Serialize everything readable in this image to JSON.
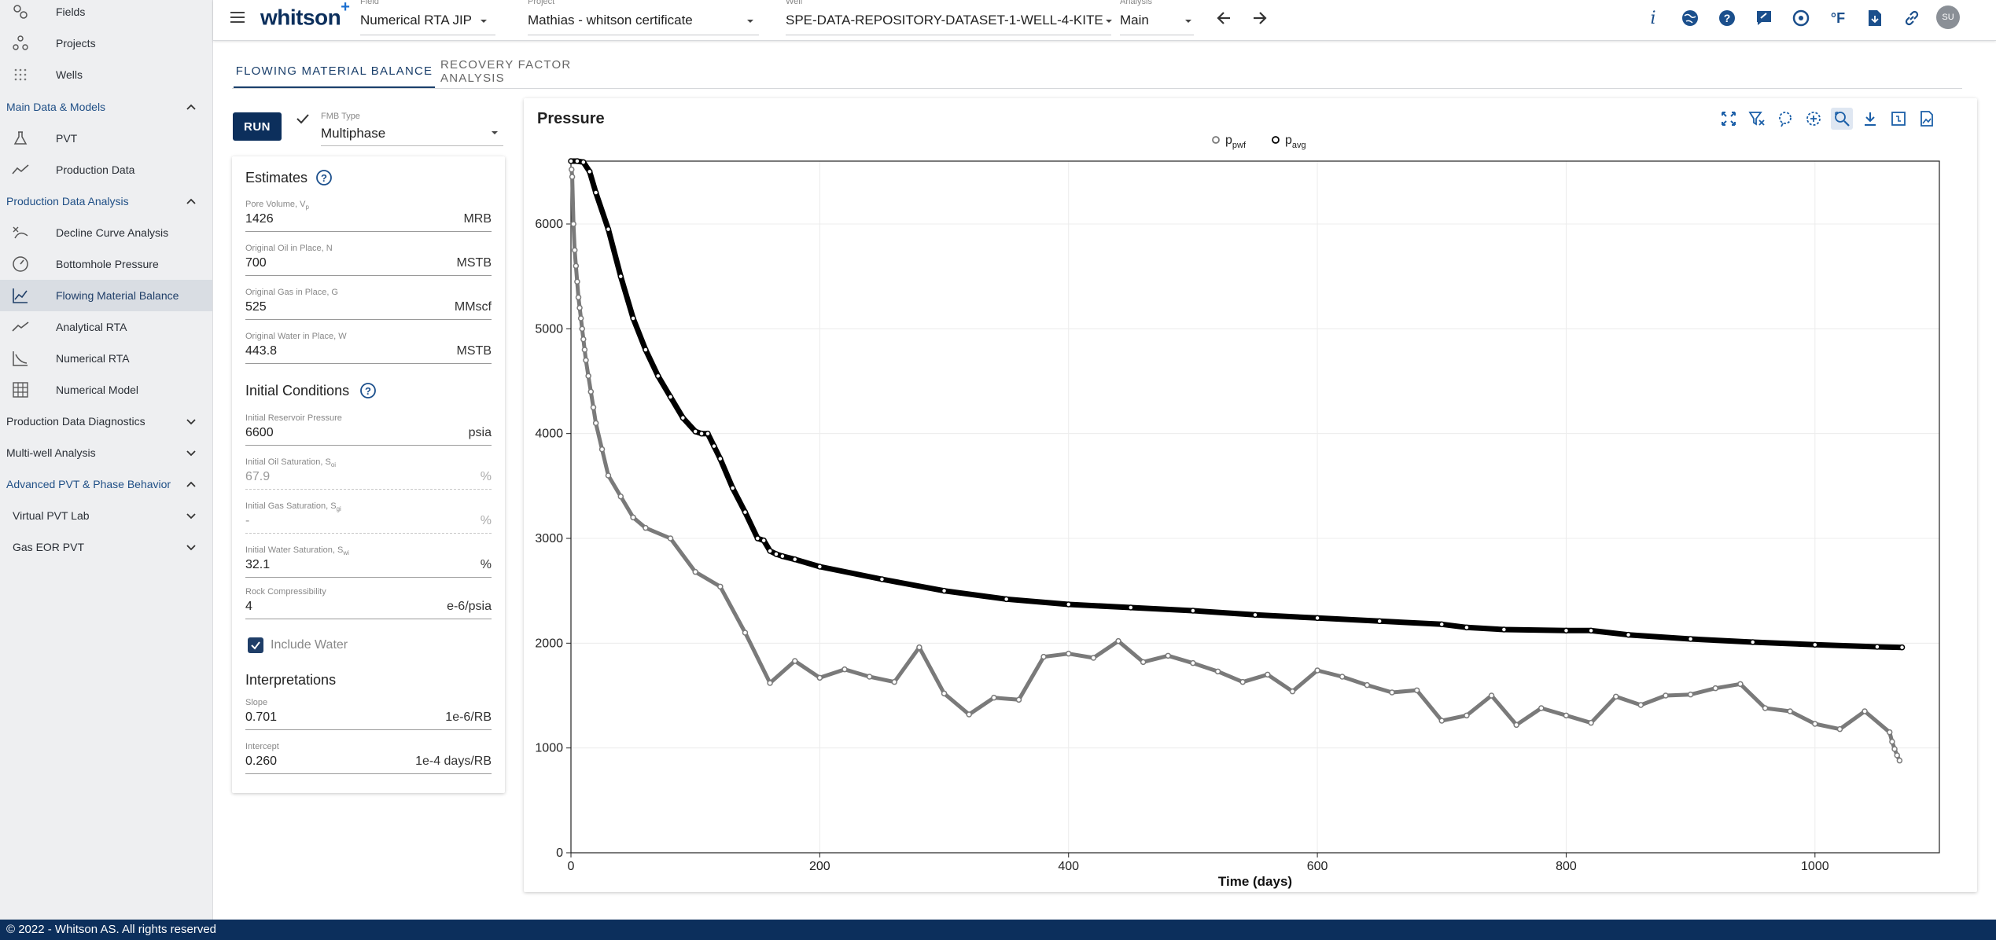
{
  "sidebar": {
    "top_items": [
      {
        "label": "Fields",
        "icon": "fields-icon"
      },
      {
        "label": "Projects",
        "icon": "projects-icon"
      },
      {
        "label": "Wells",
        "icon": "wells-icon"
      }
    ],
    "sections": {
      "main_data": "Main Data & Models",
      "production_analysis": "Production Data Analysis",
      "diagnostics": "Production Data Diagnostics",
      "multiwell": "Multi-well Analysis",
      "advanced_pvt": "Advanced PVT & Phase Behavior",
      "virtual_pvt": "Virtual PVT Lab",
      "gas_eor": "Gas EOR PVT"
    },
    "main_items": [
      {
        "label": "PVT",
        "icon": "flask-icon"
      },
      {
        "label": "Production Data",
        "icon": "trend-icon"
      }
    ],
    "analysis_items": [
      {
        "label": "Decline Curve Analysis",
        "icon": "decline-icon"
      },
      {
        "label": "Bottomhole Pressure",
        "icon": "gauge-icon"
      },
      {
        "label": "Flowing Material Balance",
        "icon": "fmb-icon",
        "active": true
      },
      {
        "label": "Analytical RTA",
        "icon": "rta-icon"
      },
      {
        "label": "Numerical RTA",
        "icon": "numerical-rta-icon"
      },
      {
        "label": "Numerical Model",
        "icon": "grid-icon"
      }
    ]
  },
  "topbar": {
    "logo": "whitson",
    "logo_plus": "+",
    "field_label": "Field",
    "field_value": "Numerical RTA JIP",
    "project_label": "Project",
    "project_value": "Mathias - whitson certificate",
    "well_label": "Well",
    "well_value": "SPE-DATA-REPOSITORY-DATASET-1-WELL-4-KITE",
    "analysis_label": "Analysis",
    "analysis_value": "Main",
    "avatar": "SU",
    "icons": [
      "info-icon",
      "globe-icon",
      "help-icon",
      "feedback-icon",
      "support-icon",
      "units-icon",
      "export-file-icon",
      "link-icon"
    ],
    "info_glyph": "i",
    "units_glyph": "°F"
  },
  "tabs": [
    {
      "label": "FLOWING MATERIAL BALANCE",
      "active": true
    },
    {
      "label": "RECOVERY FACTOR ANALYSIS",
      "active": false
    }
  ],
  "controls": {
    "run_label": "RUN",
    "fmb_type_label": "FMB Type",
    "fmb_type_value": "Multiphase"
  },
  "estimates": {
    "title": "Estimates",
    "fields": [
      {
        "label": "Pore Volume, V",
        "sub": "p",
        "value": "1426",
        "unit": "MRB"
      },
      {
        "label": "Original Oil in Place, N",
        "sub": "",
        "value": "700",
        "unit": "MSTB"
      },
      {
        "label": "Original Gas in Place, G",
        "sub": "",
        "value": "525",
        "unit": "MMscf"
      },
      {
        "label": "Original Water in Place, W",
        "sub": "",
        "value": "443.8",
        "unit": "MSTB"
      }
    ]
  },
  "initial_conditions": {
    "title": "Initial Conditions",
    "fields": [
      {
        "label": "Initial Reservoir Pressure",
        "sub": "",
        "value": "6600",
        "unit": "psia"
      },
      {
        "label": "Initial Oil Saturation, S",
        "sub": "oi",
        "value": "67.9",
        "unit": "%"
      },
      {
        "label": "Initial Gas Saturation, S",
        "sub": "gi",
        "value": "-",
        "unit": "%"
      },
      {
        "label": "Initial Water Saturation, S",
        "sub": "wi",
        "value": "32.1",
        "unit": "%"
      },
      {
        "label": "Rock Compressibility",
        "sub": "",
        "value": "4",
        "unit": "e-6/psia"
      }
    ],
    "include_water_label": "Include Water"
  },
  "interpretations": {
    "title": "Interpretations",
    "fields": [
      {
        "label": "Slope",
        "sub": "",
        "value": "0.701",
        "unit": "1e-6/RB"
      },
      {
        "label": "Intercept",
        "sub": "",
        "value": "0.260",
        "unit": "1e-4 days/RB"
      }
    ]
  },
  "chart_toolbar_icons": [
    "autoscale-icon",
    "clear-filter-icon",
    "lasso-select-icon",
    "box-select-icon",
    "zoom-icon",
    "download-icon",
    "fit-icon",
    "export-image-icon"
  ],
  "chart_data": {
    "type": "scatter",
    "title": "Pressure",
    "xlabel": "Time (days)",
    "ylabel": "",
    "xlim": [
      0,
      1100
    ],
    "ylim": [
      0,
      6600
    ],
    "xticks": [
      0,
      200,
      400,
      600,
      800,
      1000
    ],
    "yticks": [
      0,
      1000,
      2000,
      3000,
      4000,
      5000,
      6000
    ],
    "grid": true,
    "legend": "top-center",
    "series": [
      {
        "name": "p",
        "name_sub": "pwf",
        "color": "#7a7a7a",
        "x": [
          0.5,
          1,
          2,
          3,
          4,
          5,
          6,
          7,
          8,
          9,
          10,
          11,
          12,
          14,
          16,
          18,
          20,
          25,
          30,
          40,
          50,
          60,
          80,
          100,
          120,
          140,
          160,
          180,
          200,
          220,
          240,
          260,
          280,
          300,
          320,
          340,
          360,
          380,
          400,
          420,
          440,
          460,
          480,
          500,
          520,
          540,
          560,
          580,
          600,
          620,
          640,
          660,
          680,
          700,
          720,
          740,
          760,
          780,
          800,
          820,
          840,
          860,
          880,
          900,
          920,
          940,
          960,
          980,
          1000,
          1020,
          1040,
          1060,
          1062,
          1064,
          1066,
          1068
        ],
        "y": [
          6520,
          6450,
          6000,
          5750,
          5600,
          5450,
          5300,
          5200,
          5100,
          5000,
          4900,
          4800,
          4700,
          4550,
          4400,
          4250,
          4100,
          3850,
          3600,
          3400,
          3200,
          3100,
          3000,
          2680,
          2540,
          2100,
          1620,
          1830,
          1670,
          1750,
          1680,
          1630,
          1960,
          1520,
          1320,
          1480,
          1460,
          1870,
          1900,
          1860,
          2020,
          1820,
          1880,
          1810,
          1730,
          1630,
          1700,
          1540,
          1740,
          1680,
          1600,
          1530,
          1550,
          1260,
          1310,
          1500,
          1220,
          1380,
          1310,
          1240,
          1490,
          1410,
          1500,
          1510,
          1570,
          1610,
          1380,
          1350,
          1230,
          1180,
          1350,
          1150,
          1060,
          990,
          930,
          880
        ]
      },
      {
        "name": "p",
        "name_sub": "avg",
        "color": "#000000",
        "x": [
          0,
          5,
          10,
          15,
          20,
          30,
          40,
          50,
          60,
          70,
          80,
          90,
          100,
          105,
          110,
          115,
          120,
          130,
          140,
          150,
          155,
          160,
          165,
          170,
          180,
          200,
          250,
          300,
          350,
          400,
          450,
          500,
          550,
          600,
          650,
          700,
          720,
          750,
          800,
          820,
          850,
          900,
          950,
          1000,
          1050,
          1070
        ],
        "y": [
          6600,
          6600,
          6590,
          6500,
          6300,
          5950,
          5500,
          5100,
          4800,
          4550,
          4350,
          4150,
          4020,
          4000,
          4000,
          3880,
          3760,
          3480,
          3250,
          3000,
          2980,
          2880,
          2850,
          2830,
          2800,
          2730,
          2610,
          2500,
          2420,
          2370,
          2340,
          2310,
          2270,
          2240,
          2210,
          2180,
          2150,
          2130,
          2120,
          2120,
          2080,
          2040,
          2010,
          1985,
          1965,
          1960
        ]
      }
    ]
  },
  "footer": "© 2022 - Whitson AS. All rights reserved"
}
